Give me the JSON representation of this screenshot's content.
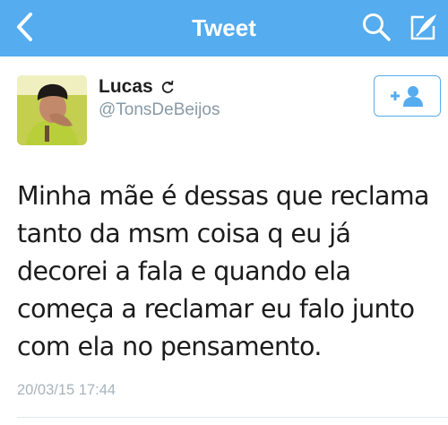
{
  "navbar": {
    "title": "Tweet",
    "back_icon": "chevron-left-icon",
    "search_icon": "search-icon",
    "compose_icon": "compose-icon",
    "background_color": "#55acee"
  },
  "tweet": {
    "author": {
      "name": "Lucas",
      "handle": "@TonsDeBeijos",
      "name_badge_icon": "retweet-icon"
    },
    "follow_button_icon": "add-user-icon",
    "text_lines": [
      "Minha mãe é dessas que reclama",
      "tanto da msm coisa q eu já",
      "decorei a fala e quando ela",
      "começa a reclamar eu falo junto",
      "com ela no pensamento."
    ],
    "timestamp": "20/03/15 17:44"
  },
  "colors": {
    "accent": "#55acee",
    "secondary_text": "#8899a6",
    "timestamp_text": "#a7b3bd"
  }
}
